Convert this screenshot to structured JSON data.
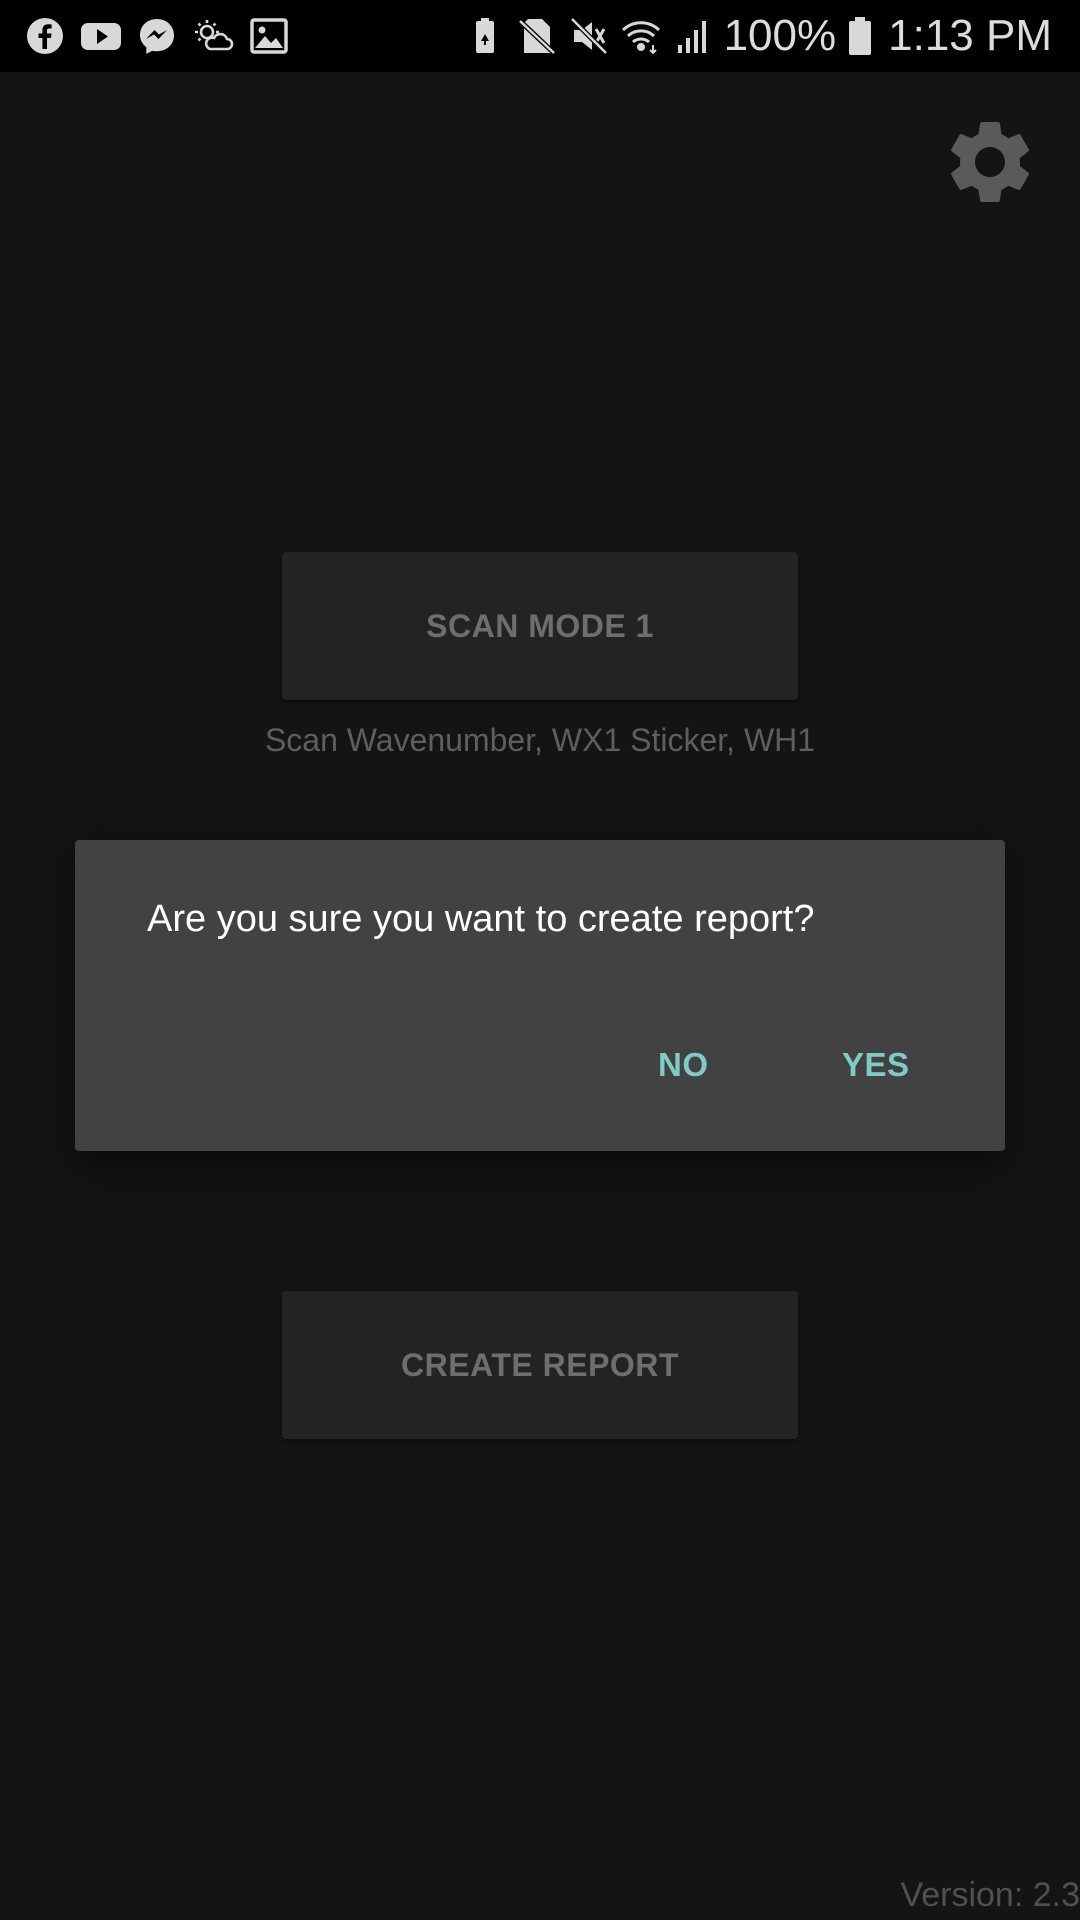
{
  "status_bar": {
    "left_icons": [
      "facebook-icon",
      "youtube-icon",
      "messenger-icon",
      "weather-icon",
      "gallery-icon"
    ],
    "right_icons": [
      "battery-saver-icon",
      "no-sim-icon",
      "mute-icon",
      "wifi-icon",
      "signal-icon"
    ],
    "battery_percent": "100%",
    "time": "1:13 PM"
  },
  "toolbar": {
    "settings_icon": "gear-icon"
  },
  "main": {
    "scan_mode_label": "SCAN MODE 1",
    "scan_description": "Scan Wavenumber, WX1 Sticker, WH1",
    "create_report_label": "CREATE REPORT"
  },
  "dialog": {
    "message": "Are you sure you want to create report?",
    "no_label": "NO",
    "yes_label": "YES"
  },
  "footer": {
    "version": "Version: 2.3"
  },
  "colors": {
    "background": "#141414",
    "button_bg": "#232323",
    "button_text": "#6e6e6e",
    "dialog_bg": "#424242",
    "accent": "#80cbc4"
  }
}
